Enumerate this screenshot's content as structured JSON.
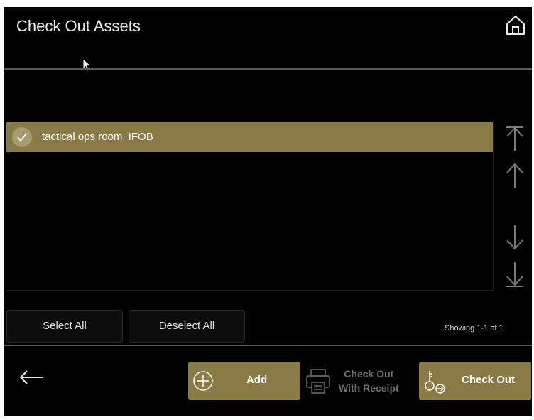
{
  "header": {
    "title": "Check Out Assets",
    "home_icon": "home-icon"
  },
  "list": {
    "items": [
      {
        "label": "tactical ops room  IFOB",
        "selected": true
      }
    ]
  },
  "scroll": {
    "top_icon": "scroll-to-top-icon",
    "up_icon": "scroll-up-icon",
    "down_icon": "scroll-down-icon",
    "bottom_icon": "scroll-to-bottom-icon"
  },
  "selection": {
    "select_all": "Select All",
    "deselect_all": "Deselect All"
  },
  "status": {
    "showing": "Showing 1-1 of 1"
  },
  "footer": {
    "back_icon": "back-arrow-icon",
    "add_label": "Add",
    "receipt_line1": "Check Out",
    "receipt_line2": "With Receipt",
    "checkout_label": "Check Out"
  },
  "colors": {
    "accent": "#8a7a45",
    "background": "#000000",
    "text": "#ffffff",
    "disabled_text": "#6e6e6e"
  }
}
